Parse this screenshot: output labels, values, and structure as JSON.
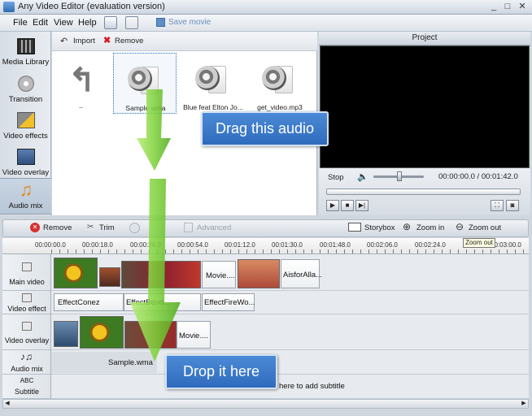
{
  "window": {
    "title": "Any Video Editor (evaluation version)",
    "controls": [
      "_",
      "□",
      "✕"
    ]
  },
  "menu": {
    "items": [
      "File",
      "Edit",
      "View",
      "Help"
    ],
    "save_movie": "Save movie"
  },
  "sidebar": {
    "items": [
      {
        "label": "Media Library",
        "icon": "film-icon"
      },
      {
        "label": "Transition",
        "icon": "transition-disc-icon"
      },
      {
        "label": "Video effects",
        "icon": "video-effects-star-icon"
      },
      {
        "label": "Video overlay",
        "icon": "video-overlay-icon"
      },
      {
        "label": "Audio mix",
        "icon": "music-note-icon",
        "active": true
      }
    ]
  },
  "library": {
    "import_label": "Import",
    "remove_label": "Remove",
    "up_label": "..",
    "files": [
      {
        "name": "Sample.wma",
        "selected": true
      },
      {
        "name": "Blue feat Elton Jo...",
        "selected": false
      },
      {
        "name": "get_video.mp3",
        "selected": false
      }
    ]
  },
  "project": {
    "title": "Project",
    "stop_label": "Stop",
    "time": "00:00:00.0 / 00:01:42.0"
  },
  "timeline_toolbar": {
    "remove": "Remove",
    "trim": "Trim",
    "advanced": "Advanced",
    "storybox": "Storybox",
    "zoom_in": "Zoom in",
    "zoom_out": "Zoom out",
    "tooltip": "Zoom out"
  },
  "ruler": {
    "ticks": [
      "00:00:00.0",
      "00:00:18.0",
      "00:00:36.0",
      "00:00:54.0",
      "00:01:12.0",
      "00:01:30.0",
      "00:01:48.0",
      "00:02:06.0",
      "00:02:24.0",
      "00:03:00.0"
    ]
  },
  "tracks": {
    "main_video": {
      "label": "Main video",
      "clips": [
        "Movie....",
        "AisforAlla..."
      ]
    },
    "video_effect": {
      "label": "Video effect",
      "clips": [
        "EffectConez",
        "EffectBend...",
        "EffectFireWo..."
      ]
    },
    "video_overlay": {
      "label": "Video overlay",
      "clips": [
        "Movie...."
      ]
    },
    "audio_mix": {
      "label": "Audio mix",
      "clips": [
        "Sample.wma"
      ]
    },
    "subtitle": {
      "label": "Subtitle",
      "abc": "ABC",
      "hint": "here to add subtitle"
    }
  },
  "callouts": {
    "drag": "Drag this audio",
    "drop": "Drop it here"
  },
  "colors": {
    "accent_blue": "#2f6bbd",
    "arrow_green": "#7fd23a",
    "panel_bg": "#e7eaee"
  }
}
